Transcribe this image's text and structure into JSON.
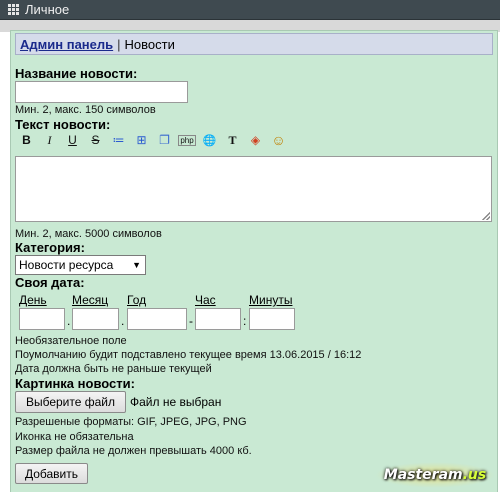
{
  "window": {
    "title": "Личное"
  },
  "breadcrumb": {
    "admin_link": "Админ панель",
    "separator": "|",
    "current": "Новости"
  },
  "form": {
    "news_title": {
      "label": "Название новости:",
      "value": "",
      "hint": "Мин. 2, макс. 150 символов"
    },
    "news_text": {
      "label": "Текст новости:",
      "value": "",
      "hint": "Мин. 2, макс. 5000 символов",
      "toolbar": [
        {
          "icon": "bold-icon",
          "glyph": "B"
        },
        {
          "icon": "italic-icon",
          "glyph": "I"
        },
        {
          "icon": "underline-icon",
          "glyph": "U"
        },
        {
          "icon": "strikethrough-icon",
          "glyph": "S"
        },
        {
          "icon": "list-icon",
          "glyph": "≔"
        },
        {
          "icon": "spoiler-icon",
          "glyph": "⊞"
        },
        {
          "icon": "quote-icon",
          "glyph": "❐"
        },
        {
          "icon": "php-code-icon",
          "glyph": "php"
        },
        {
          "icon": "link-icon",
          "glyph": "🌐"
        },
        {
          "icon": "text-color-icon",
          "glyph": "T"
        },
        {
          "icon": "fill-color-icon",
          "glyph": "◈"
        },
        {
          "icon": "smiley-icon",
          "glyph": "☺"
        }
      ]
    },
    "category": {
      "label": "Категория:",
      "selected": "Новости ресурса"
    },
    "custom_date": {
      "label": "Своя дата:",
      "fields": [
        {
          "label": "День",
          "value": ""
        },
        {
          "label": "Месяц",
          "value": ""
        },
        {
          "label": "Год",
          "value": ""
        },
        {
          "label": "Час",
          "value": ""
        },
        {
          "label": "Минуты",
          "value": ""
        }
      ],
      "separators": [
        ".",
        ".",
        "-",
        ":"
      ],
      "notes": [
        "Необязательное поле",
        "Поумолчанию будит подставлено текущее время 13.06.2015 / 16:12",
        "Дата должна быть не раньше текущей"
      ]
    },
    "image": {
      "label": "Картинка новости:",
      "choose_button": "Выберите файл",
      "no_file": "Файл не выбран",
      "notes": [
        "Разрешеные форматы: GIF, JPEG, JPG, PNG",
        "Иконка не обязательна",
        "Размер файла не должен превышать 4000 кб."
      ]
    },
    "submit_label": "Добавить"
  },
  "watermark": {
    "brand": "Masteram",
    "suffix": ".us"
  },
  "colors": {
    "titlebar": "#3f4a50",
    "panel": "#c9e9d3",
    "breadcrumb": "#d5dbea",
    "link": "#1a2a8c"
  }
}
